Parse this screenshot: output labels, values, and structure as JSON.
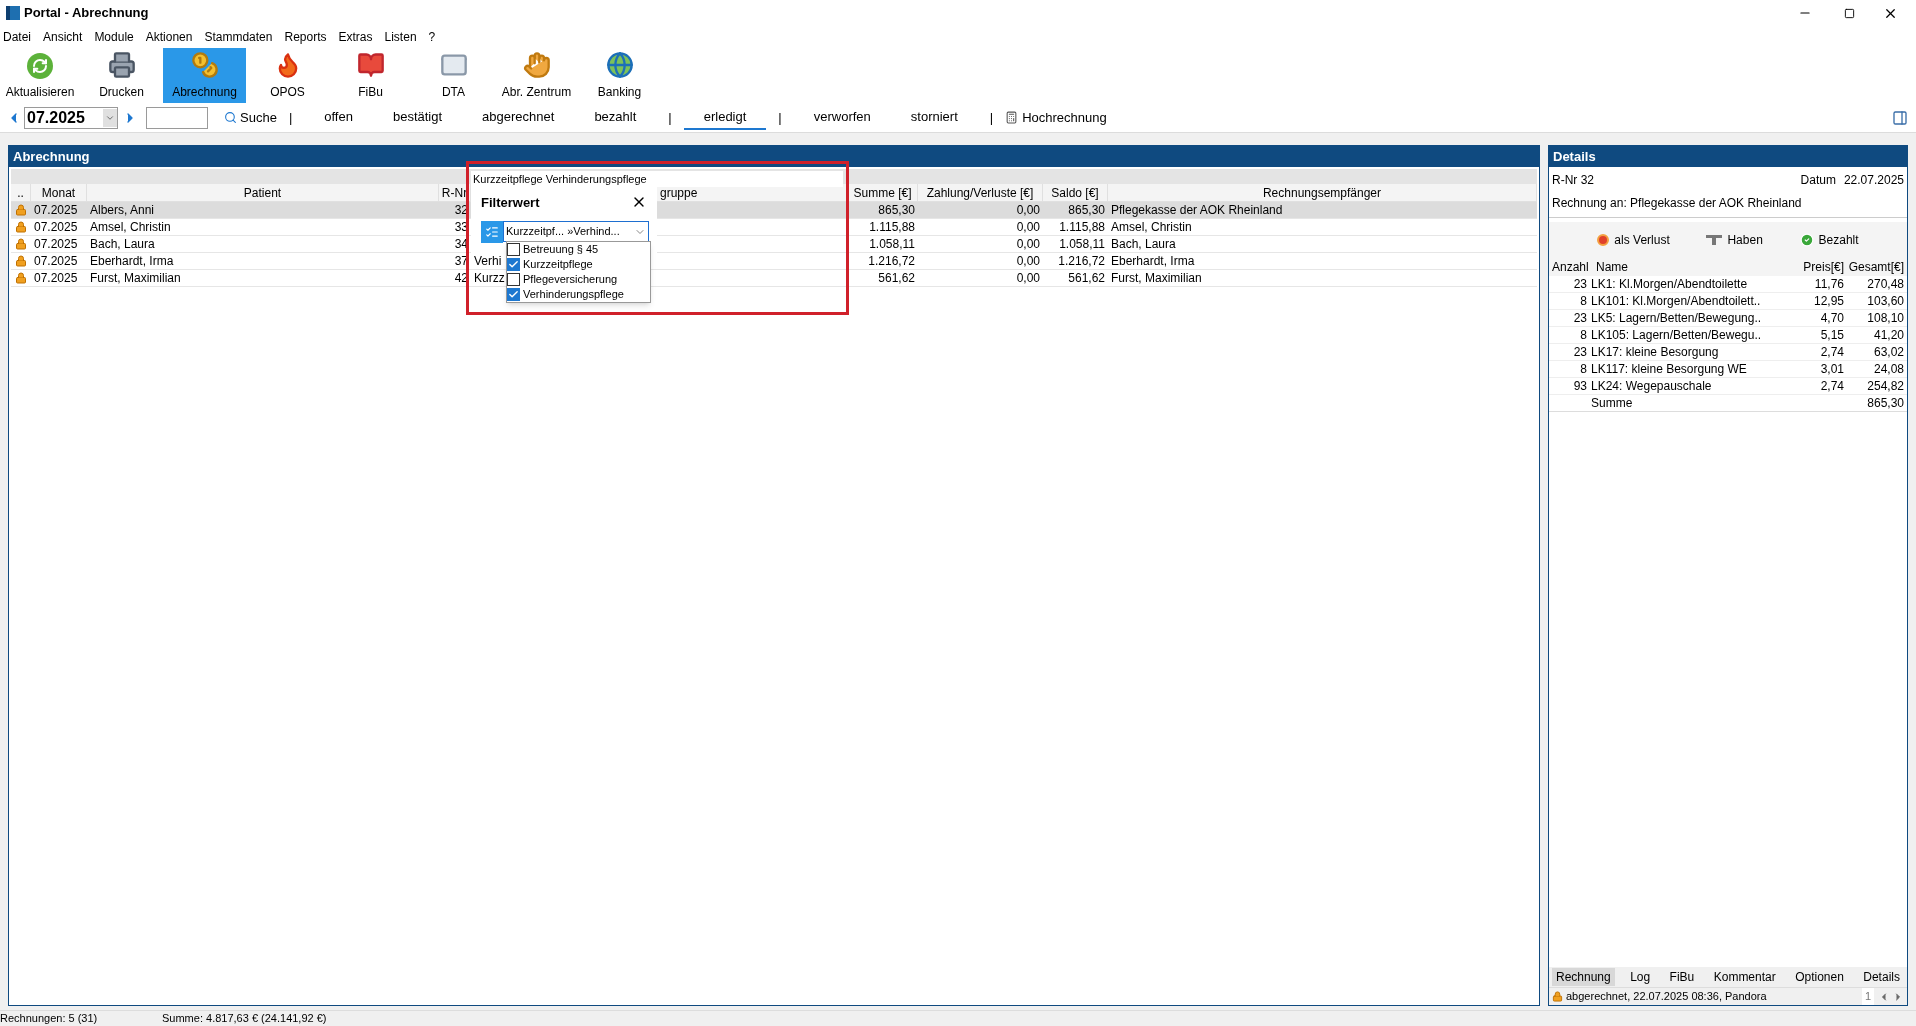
{
  "window": {
    "title": "Portal - Abrechnung"
  },
  "menu": [
    "Datei",
    "Ansicht",
    "Module",
    "Aktionen",
    "Stammdaten",
    "Reports",
    "Extras",
    "Listen",
    "?"
  ],
  "toolbar": [
    {
      "label": "Aktualisieren",
      "selected": false
    },
    {
      "label": "Drucken",
      "selected": false
    },
    {
      "label": "Abrechnung",
      "selected": true
    },
    {
      "label": "OPOS",
      "selected": false
    },
    {
      "label": "FiBu",
      "selected": false
    },
    {
      "label": "DTA",
      "selected": false
    },
    {
      "label": "Abr. Zentrum",
      "selected": false
    },
    {
      "label": "Banking",
      "selected": false
    }
  ],
  "nav": {
    "period": "07.2025",
    "search_button": "Suche",
    "items": [
      {
        "kind": "separator",
        "label": "|"
      },
      {
        "kind": "tab",
        "label": "offen",
        "selected": false
      },
      {
        "kind": "tab",
        "label": "bestätigt",
        "selected": false
      },
      {
        "kind": "tab",
        "label": "abgerechnet",
        "selected": false
      },
      {
        "kind": "tab",
        "label": "bezahlt",
        "selected": false
      },
      {
        "kind": "separator",
        "label": "|"
      },
      {
        "kind": "tab",
        "label": "erledigt",
        "selected": true
      },
      {
        "kind": "separator",
        "label": "|"
      },
      {
        "kind": "tab",
        "label": "verworfen",
        "selected": false
      },
      {
        "kind": "tab",
        "label": "storniert",
        "selected": false
      },
      {
        "kind": "separator",
        "label": "|"
      },
      {
        "kind": "tool",
        "label": "Hochrechnung"
      }
    ]
  },
  "table": {
    "title": "Abrechnung",
    "columns": [
      "..",
      "Monat",
      "Patient",
      "R-Nr",
      "gruppe",
      "Summe [€]",
      "Zahlung/Verluste [€]",
      "Saldo [€]",
      "Rechnungsempfänger"
    ],
    "rows": [
      {
        "selected": true,
        "locked": true,
        "monat": "07.2025",
        "patient": "Albers, Anni",
        "r_nr": "32",
        "summe": "865,30",
        "zahlung": "0,00",
        "saldo": "865,30",
        "empfaenger": "Pflegekasse der AOK Rheinland"
      },
      {
        "selected": false,
        "locked": true,
        "monat": "07.2025",
        "patient": "Amsel, Christin",
        "r_nr": "33",
        "summe": "1.115,88",
        "zahlung": "0,00",
        "saldo": "1.115,88",
        "empfaenger": "Amsel, Christin"
      },
      {
        "selected": false,
        "locked": true,
        "monat": "07.2025",
        "patient": "Bach, Laura",
        "r_nr": "34",
        "summe": "1.058,11",
        "zahlung": "0,00",
        "saldo": "1.058,11",
        "empfaenger": "Bach, Laura"
      },
      {
        "selected": false,
        "locked": true,
        "monat": "07.2025",
        "patient": "Eberhardt, Irma",
        "r_nr": "37",
        "column_5": "Verhi",
        "summe": "1.216,72",
        "zahlung": "0,00",
        "saldo": "1.216,72",
        "empfaenger": "Eberhardt, Irma"
      },
      {
        "selected": false,
        "locked": true,
        "monat": "07.2025",
        "patient": "Furst, Maximilian",
        "r_nr": "42",
        "column_5": "Kurzz",
        "summe": "561,62",
        "zahlung": "0,00",
        "saldo": "561,62",
        "empfaenger": "Furst, Maximilian"
      }
    ]
  },
  "filter_popup": {
    "filter_text": "Kurzzeitpflege Verhinderungspflege",
    "title": "Filterwert",
    "value": "Kurzzeitpf... »Verhind...",
    "options": [
      {
        "label": "Betreuung § 45",
        "checked": false
      },
      {
        "label": "Kurzzeitpflege",
        "checked": true
      },
      {
        "label": "Pflegeversicherung",
        "checked": false
      },
      {
        "label": "Verhinderungspflege",
        "checked": true
      }
    ]
  },
  "details": {
    "title": "Details",
    "r_nr": "R-Nr 32",
    "datum_label": "Datum",
    "datum": "22.07.2025",
    "recipient": "Rechnung an: Pflegekasse der AOK Rheinland",
    "actions": [
      "als Verlust",
      "Haben",
      "Bezahlt"
    ],
    "columns": [
      "Anzahl",
      "Name",
      "Preis[€]",
      "Gesamt[€]"
    ],
    "items": [
      {
        "anzahl": "23",
        "name": "LK1: Kl.Morgen/Abendtoilette",
        "preis": "11,76",
        "gesamt": "270,48"
      },
      {
        "anzahl": "8",
        "name": "LK101: Kl.Morgen/Abendtoilett..",
        "preis": "12,95",
        "gesamt": "103,60"
      },
      {
        "anzahl": "23",
        "name": "LK5: Lagern/Betten/Bewegung..",
        "preis": "4,70",
        "gesamt": "108,10"
      },
      {
        "anzahl": "8",
        "name": "LK105: Lagern/Betten/Bewegu..",
        "preis": "5,15",
        "gesamt": "41,20"
      },
      {
        "anzahl": "23",
        "name": "LK17: kleine Besorgung",
        "preis": "2,74",
        "gesamt": "63,02"
      },
      {
        "anzahl": "8",
        "name": "LK117: kleine Besorgung WE",
        "preis": "3,01",
        "gesamt": "24,08"
      },
      {
        "anzahl": "93",
        "name": "LK24: Wegepauschale",
        "preis": "2,74",
        "gesamt": "254,82"
      }
    ],
    "sum": {
      "label": "Summe",
      "value": "865,30"
    },
    "tabs": [
      {
        "label": "Rechnung",
        "selected": true
      },
      {
        "label": "Log",
        "selected": false
      },
      {
        "label": "FiBu",
        "selected": false
      },
      {
        "label": "Kommentar",
        "selected": false
      },
      {
        "label": "Optionen",
        "selected": false
      },
      {
        "label": "Details",
        "selected": false
      }
    ],
    "status": {
      "text": "abgerechnet, 22.07.2025 08:36, Pandora",
      "locked": true,
      "page": "1"
    }
  },
  "status_bar": [
    "Rechnungen: 5 (31)",
    "Summe: 4.817,63 € (24.141,92 €)"
  ]
}
